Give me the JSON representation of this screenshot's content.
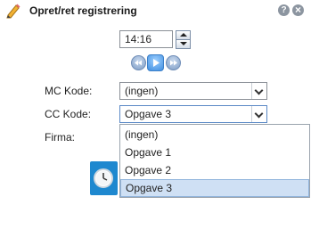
{
  "dialog": {
    "title": "Opret/ret registrering",
    "help_label": "?",
    "close_label": "×"
  },
  "time": {
    "value": "14:16"
  },
  "fields": {
    "mc_label": "MC Kode:",
    "mc_value": "(ingen)",
    "cc_label": "CC Kode:",
    "cc_value": "Opgave 3",
    "firma_label": "Firma:"
  },
  "dropdown": {
    "options": [
      "(ingen)",
      "Opgave 1",
      "Opgave 2",
      "Opgave 3"
    ],
    "selected": "Opgave 3"
  },
  "colors": {
    "accent": "#1e88cf",
    "selected_bg": "#cfe0f4"
  }
}
